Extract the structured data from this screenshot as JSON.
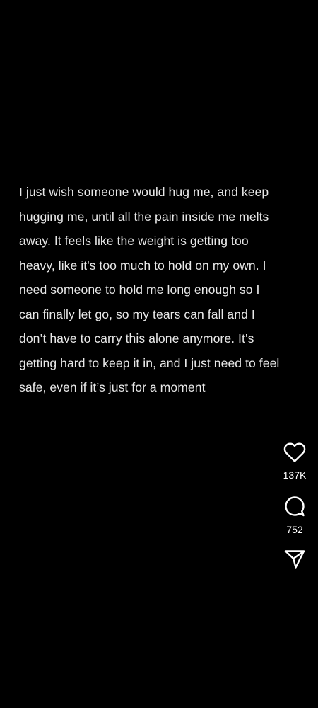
{
  "post": {
    "caption": "I just wish someone would hug me, and keep\nhugging me, until all the pain inside me melts\naway. It feels like the weight is getting too\nheavy, like it's too much to hold on my own. I\nneed someone to hold me long enough so I\ncan finally let go, so my tears can fall and I\ndon’t have to carry this alone anymore. It’s\ngetting hard to keep it in, and I just need to feel\nsafe, even if it’s just for a moment"
  },
  "actions": {
    "like": {
      "icon": "heart-icon",
      "count": "137K"
    },
    "comment": {
      "icon": "comment-icon",
      "count": "752"
    },
    "share": {
      "icon": "send-icon"
    }
  },
  "colors": {
    "background": "#000000",
    "text": "#e8e8e8",
    "icon": "#ffffff"
  }
}
